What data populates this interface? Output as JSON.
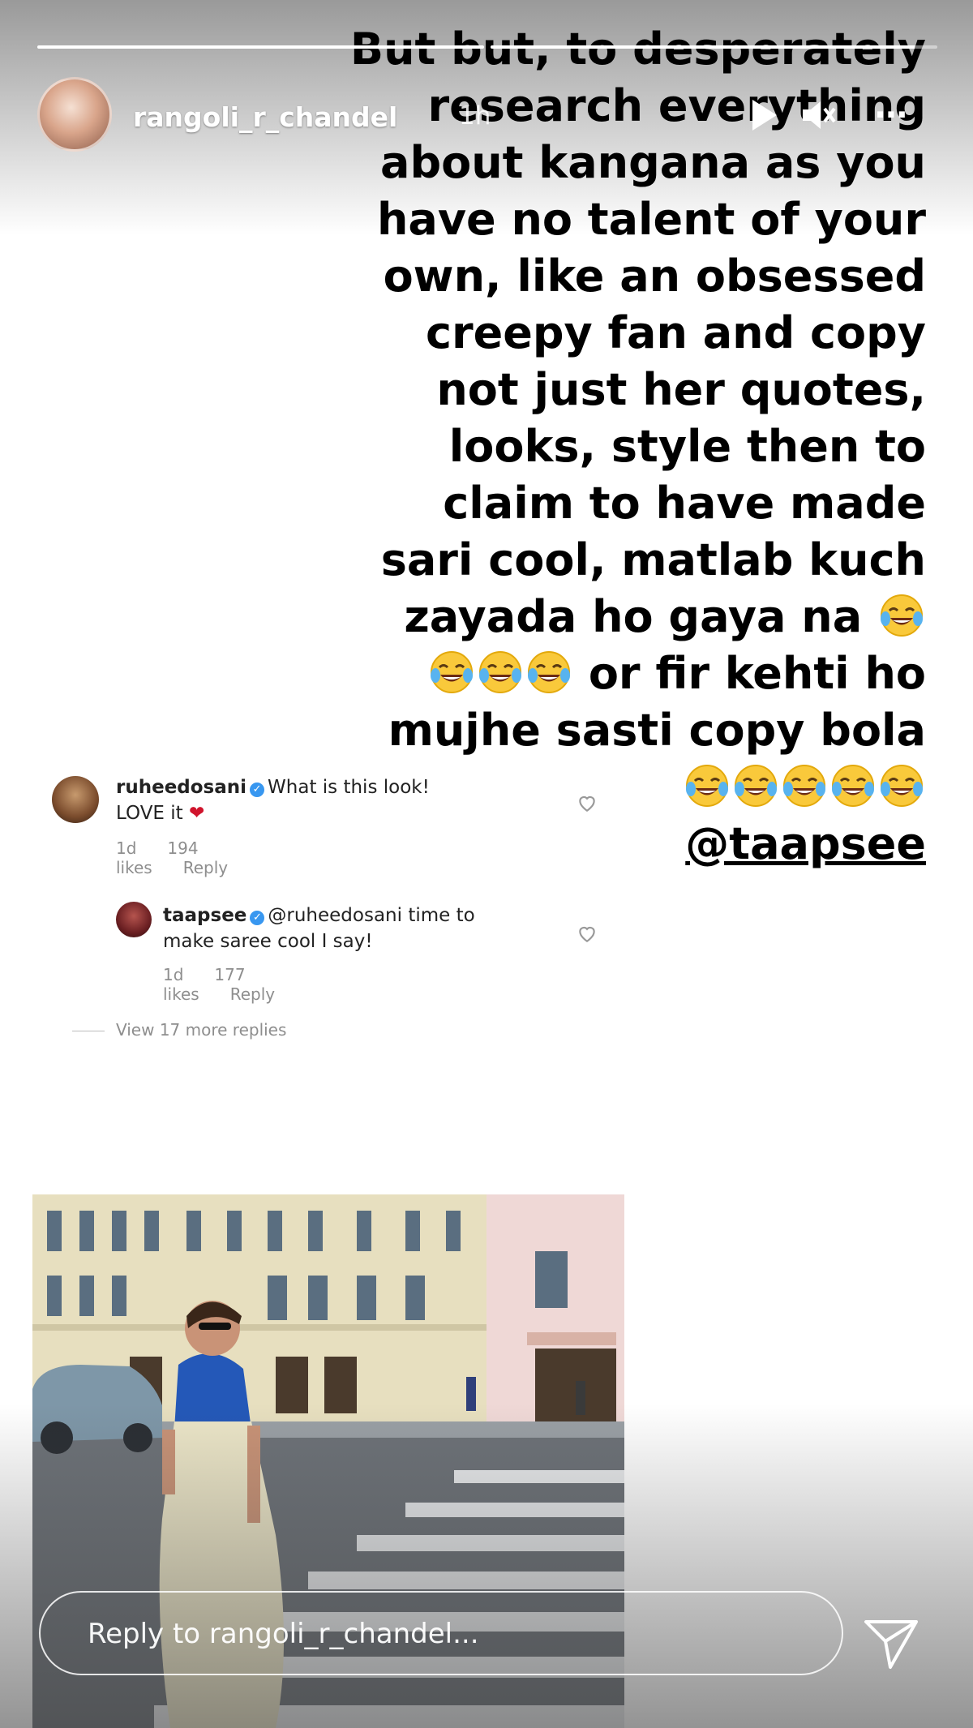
{
  "story": {
    "segments": [
      {
        "progress": 1.0
      },
      {
        "progress": 0.95
      }
    ],
    "header": {
      "username": "rangoli_r_chandel",
      "time": "1h"
    },
    "text_lines": [
      "But but, to desperately",
      "research everything",
      "about kangana as you",
      "have no talent of your",
      "own, like  an obsessed",
      "creepy fan and copy",
      "not just her quotes,",
      "looks, style then to",
      "claim to have made",
      "sari cool, matlab kuch",
      "zayada ho gaya na",
      "or fir kehti ho",
      "mujhe sasti copy bola"
    ],
    "mention": "@taapsee",
    "icons": {
      "play": "play-icon",
      "mute": "mute-icon",
      "more": "more-icon",
      "emoji": "tears-of-joy-emoji",
      "send": "send-icon"
    }
  },
  "comments": [
    {
      "username": "ruheedosani",
      "text": "What is this look! LOVE it",
      "age": "1d",
      "likes": "194 likes",
      "reply": "Reply"
    },
    {
      "username": "taapsee",
      "mention": "@ruheedosani",
      "text": "time to make saree cool I say!",
      "age": "1d",
      "likes": "177 likes",
      "reply": "Reply"
    }
  ],
  "view_replies": "View 17 more replies",
  "reply_bar": {
    "placeholder": "Reply to rangoli_r_chandel..."
  },
  "colors": {
    "verified": "#3897f0",
    "heart": "#d0142c"
  }
}
